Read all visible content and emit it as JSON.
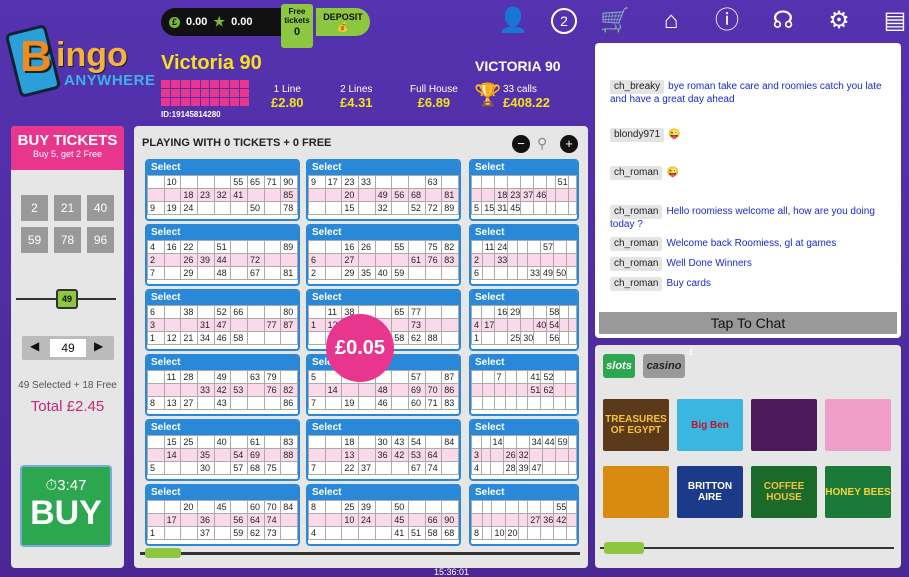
{
  "header": {
    "logo": {
      "b": "B",
      "ingo": "ingo",
      "any": "ANYWHERE"
    },
    "balance_cash": "0.00",
    "balance_bonus": "0.00",
    "free_tickets_label": "Free tickets",
    "free_tickets": "0",
    "deposit_label": "DEPOSIT"
  },
  "game": {
    "name": "Victoria 90",
    "id": "ID:19145814280",
    "prizes": [
      {
        "label": "1 Line",
        "value": "£2.80"
      },
      {
        "label": "2 Lines",
        "value": "£4.31"
      },
      {
        "label": "Full House",
        "value": "£6.89"
      }
    ],
    "room_name": "VICTORIA 90",
    "calls": "33 calls",
    "jackpot": "£408.22"
  },
  "icons": [
    "user-icon",
    "notification-icon",
    "cart-icon",
    "home-icon",
    "info-icon",
    "support-icon",
    "settings-icon",
    "document-icon"
  ],
  "badge_count": "2",
  "buy": {
    "title": "BUY TICKETS",
    "subtitle": "Buy 5, get 2 Free",
    "quick": [
      "2",
      "21",
      "40",
      "59",
      "78",
      "96"
    ],
    "slider_value": "49",
    "spinner_value": "49",
    "selected": "49 Selected + 18 Free",
    "total": "Total £2.45",
    "timer": "3:47",
    "buy_label": "BUY"
  },
  "main": {
    "heading": "PLAYING WITH 0 TICKETS + 0 FREE",
    "price": "£0.05",
    "select": "Select"
  },
  "tickets": [
    [
      [
        "",
        "10",
        "",
        "",
        "",
        "55",
        "65",
        "71",
        "90"
      ],
      [
        "",
        "",
        "18",
        "23",
        "32",
        "41",
        "",
        "",
        "85"
      ],
      [
        "9",
        "19",
        "24",
        "",
        "",
        "",
        "50",
        "",
        "78"
      ]
    ],
    [
      [
        "9",
        "17",
        "23",
        "33",
        "",
        "",
        "",
        "63",
        ""
      ],
      [
        "",
        "",
        "20",
        "",
        "49",
        "56",
        "68",
        "",
        "81"
      ],
      [
        "",
        "",
        "15",
        "",
        "32",
        "",
        "52",
        "72",
        "89"
      ]
    ],
    [
      [
        "",
        "",
        "",
        "",
        "",
        "",
        "",
        "51",
        ""
      ],
      [
        "",
        "",
        "18",
        "23",
        "37",
        "46",
        "",
        "",
        ""
      ],
      [
        "5",
        "15",
        "31",
        "45",
        "",
        "",
        "",
        "",
        ""
      ]
    ],
    [
      [
        "4",
        "16",
        "22",
        "",
        "51",
        "",
        "",
        "",
        "89"
      ],
      [
        "2",
        "",
        "26",
        "39",
        "44",
        "",
        "72",
        "",
        ""
      ],
      [
        "7",
        "",
        "29",
        "",
        "48",
        "",
        "67",
        "",
        "81"
      ]
    ],
    [
      [
        "",
        "",
        "16",
        "26",
        "",
        "55",
        "",
        "75",
        "82"
      ],
      [
        "6",
        "",
        "27",
        "",
        "",
        "",
        "61",
        "76",
        "83"
      ],
      [
        "2",
        "",
        "29",
        "35",
        "40",
        "59",
        "",
        "",
        ""
      ]
    ],
    [
      [
        "",
        "11",
        "24",
        "",
        "",
        "",
        "57",
        "",
        ""
      ],
      [
        "2",
        "",
        "33",
        "",
        "",
        "",
        "",
        "",
        ""
      ],
      [
        "6",
        "",
        "",
        "",
        "",
        "33",
        "49",
        "50",
        ""
      ]
    ],
    [
      [
        "6",
        "",
        "38",
        "",
        "52",
        "66",
        "",
        "",
        "80"
      ],
      [
        "3",
        "",
        "",
        "31",
        "47",
        "",
        "",
        "77",
        "87"
      ],
      [
        "1",
        "12",
        "21",
        "34",
        "46",
        "58",
        "",
        "",
        ""
      ]
    ],
    [
      [
        "",
        "11",
        "38",
        "",
        "",
        "65",
        "77",
        "",
        ""
      ],
      [
        "1",
        "12",
        "",
        "",
        "",
        "",
        "73",
        "",
        ""
      ],
      [
        "",
        "",
        "",
        "",
        "",
        "58",
        "62",
        "88",
        ""
      ]
    ],
    [
      [
        "",
        "",
        "16",
        "29",
        "",
        "",
        "58",
        "",
        ""
      ],
      [
        "4",
        "17",
        "",
        "",
        "",
        "40",
        "54",
        "",
        ""
      ],
      [
        "1",
        "",
        "",
        "25",
        "30",
        "",
        "56",
        "",
        ""
      ]
    ],
    [
      [
        "",
        "11",
        "28",
        "",
        "49",
        "",
        "63",
        "79",
        ""
      ],
      [
        "",
        "",
        "",
        "33",
        "42",
        "53",
        "",
        "76",
        "82"
      ],
      [
        "8",
        "13",
        "27",
        "",
        "43",
        "",
        "",
        "",
        "86"
      ]
    ],
    [
      [
        "5",
        "",
        "",
        "",
        "",
        "",
        "57",
        "",
        "87"
      ],
      [
        "",
        "14",
        "",
        "",
        "48",
        "",
        "69",
        "70",
        "86"
      ],
      [
        "7",
        "",
        "19",
        "",
        "46",
        "",
        "60",
        "71",
        "83"
      ]
    ],
    [
      [
        "",
        "",
        "7",
        "",
        "",
        "41",
        "52",
        "",
        "",
        ""
      ],
      [
        "",
        "",
        "",
        "",
        "",
        "51",
        "62",
        "",
        ""
      ],
      [
        "",
        "",
        "",
        "",
        "",
        "",
        "",
        "",
        "",
        ""
      ]
    ],
    [
      [
        "",
        "15",
        "25",
        "",
        "40",
        "",
        "61",
        "",
        "83"
      ],
      [
        "",
        "14",
        "",
        "35",
        "",
        "54",
        "69",
        "",
        "88"
      ],
      [
        "5",
        "",
        "",
        "30",
        "",
        "57",
        "68",
        "75",
        ""
      ]
    ],
    [
      [
        "",
        "",
        "18",
        "",
        "30",
        "43",
        "54",
        "",
        "84"
      ],
      [
        "",
        "",
        "13",
        "",
        "36",
        "42",
        "53",
        "64",
        ""
      ],
      [
        "7",
        "",
        "22",
        "37",
        "",
        "",
        "67",
        "74",
        ""
      ]
    ],
    [
      [
        "",
        "",
        "14",
        "",
        "",
        "34",
        "44",
        "59",
        ""
      ],
      [
        "3",
        "",
        "",
        "26",
        "32",
        "",
        "",
        "",
        ""
      ],
      [
        "4",
        "",
        "",
        "28",
        "39",
        "47",
        "",
        "",
        ""
      ]
    ],
    [
      [
        "",
        "",
        "20",
        "",
        "45",
        "",
        "60",
        "70",
        "84"
      ],
      [
        "",
        "17",
        "",
        "36",
        "",
        "56",
        "64",
        "74",
        ""
      ],
      [
        "1",
        "",
        "",
        "37",
        "",
        "59",
        "62",
        "73",
        ""
      ]
    ],
    [
      [
        "8",
        "",
        "25",
        "39",
        "",
        "50",
        "",
        "",
        ""
      ],
      [
        "",
        "",
        "10",
        "24",
        "",
        "45",
        "",
        "66",
        "90"
      ],
      [
        "4",
        "",
        "",
        "",
        "",
        "41",
        "51",
        "58",
        "68"
      ]
    ],
    [
      [
        "",
        "",
        "",
        "",
        "",
        "",
        "",
        "55",
        ""
      ],
      [
        "",
        "",
        "",
        "",
        "",
        "27",
        "36",
        "42",
        ""
      ],
      [
        "8",
        "",
        "10",
        "20",
        "",
        "",
        "",
        "",
        ""
      ]
    ]
  ],
  "chat": {
    "messages": [
      {
        "name": "ch_breaky",
        "text": "bye roman take care and roomies catch you late and have a great day ahead"
      },
      {
        "name": "blondy971",
        "text": ""
      },
      {
        "name": "ch_roman",
        "text": ""
      },
      {
        "name": "ch_roman",
        "text": "Hello roomiess    welcome all, how are you doing today ?"
      },
      {
        "name": "ch_roman",
        "text": "Welcome back Roomiess, gl at games"
      },
      {
        "name": "ch_roman",
        "text": "Well Done Winners"
      },
      {
        "name": "ch_roman",
        "text": "Buy cards"
      }
    ],
    "tap_label": "Tap To Chat"
  },
  "games": {
    "tabs": [
      "slots",
      "casino"
    ],
    "pound": "£",
    "tiles": [
      "TREASURES OF EGYPT",
      "Big Ben",
      "",
      "",
      "",
      "BRITTON AIRE",
      "COFFEE HOUSE",
      "HONEY BEES"
    ]
  },
  "clock": "15:36:01"
}
